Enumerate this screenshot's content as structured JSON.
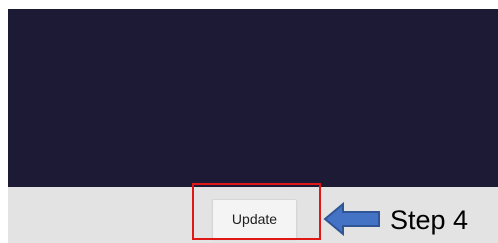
{
  "window": {
    "content_panel_color": "#1d1a36",
    "footer_color": "#e3e3e3"
  },
  "footer": {
    "update_label": "Update"
  },
  "annotation": {
    "highlight_color": "#e01818",
    "arrow_icon": "left-arrow-icon",
    "arrow_color": "#4472c4",
    "step_label": "Step 4"
  }
}
